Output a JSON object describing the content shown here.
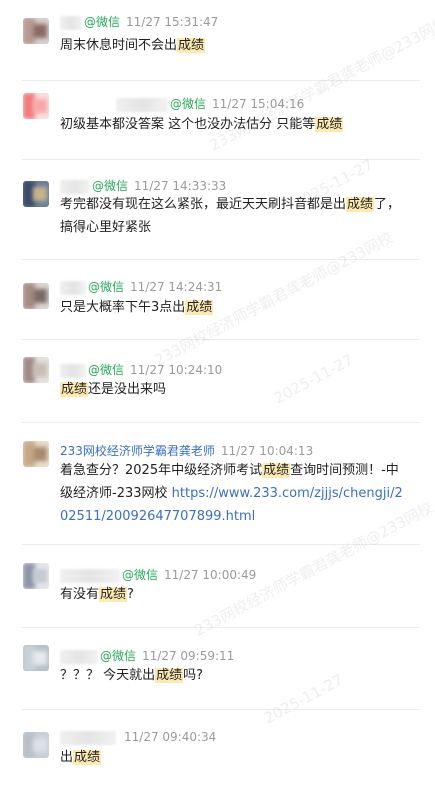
{
  "comments": [
    {
      "id": "c1",
      "nickname": "",
      "source": "@微信",
      "time": "11/27 15:31:47",
      "avatar_colors": [
        "#b89a93",
        "#8a6a66",
        "#d8cfcc"
      ],
      "segments": [
        {
          "text": "周末休息时间不会出",
          "hl": false
        },
        {
          "text": "成绩",
          "hl": true
        }
      ]
    },
    {
      "id": "c2",
      "nickname": "",
      "source": "@微信",
      "time": "11/27 15:04:16",
      "avatar_colors": [
        "#f27c7c",
        "#f6a7a7",
        "#fbdede"
      ],
      "segments": [
        {
          "text": "初级基本都没答案 这个也没办法估分 只能等",
          "hl": false
        },
        {
          "text": "成绩",
          "hl": true
        }
      ]
    },
    {
      "id": "c3",
      "nickname": "",
      "source": "@微信",
      "time": "11/27 14:33:33",
      "avatar_colors": [
        "#3b4a66",
        "#c7b38a",
        "#6d7f9a"
      ],
      "segments": [
        {
          "text": "考完都没有现在这么紧张，最近天天刷抖音都是出",
          "hl": false
        },
        {
          "text": "成绩",
          "hl": true
        },
        {
          "text": "了，搞得心里好紧张",
          "hl": false
        }
      ]
    },
    {
      "id": "c4",
      "nickname": "",
      "source": "@微信",
      "time": "11/27 14:24:31",
      "avatar_colors": [
        "#a88c85",
        "#7d6a66",
        "#ddd4d1"
      ],
      "segments": [
        {
          "text": "只是大概率下午3点出",
          "hl": false
        },
        {
          "text": "成绩",
          "hl": true
        }
      ]
    },
    {
      "id": "c5",
      "nickname": "",
      "source": "@微信",
      "time": "11/27 10:24:10",
      "avatar_colors": [
        "#9e8a86",
        "#c9bdb9",
        "#e6e0de"
      ],
      "segments": [
        {
          "text": "成绩",
          "hl": true
        },
        {
          "text": "还是没出来吗",
          "hl": false
        }
      ]
    },
    {
      "id": "c6",
      "nickname": "233网校经济师学霸君龚老师",
      "source": "",
      "time": "11/27 10:04:13",
      "avatar_colors": [
        "#c9a888",
        "#a98a6e",
        "#e9dccd"
      ],
      "segments": [
        {
          "text": "着急查分？2025年中级经济师考试",
          "hl": false
        },
        {
          "text": "成绩",
          "hl": true
        },
        {
          "text": "查询时间预测！-中级经济师-233网校 ",
          "hl": false
        },
        {
          "text": "https://www.233.com/zjjjs/chengji/202511/20092647707899.html",
          "hl": false,
          "link": true
        }
      ]
    },
    {
      "id": "c7",
      "nickname": "",
      "source": "@微信",
      "time": "11/27 10:00:49",
      "avatar_colors": [
        "#8d95a6",
        "#c4c8d1",
        "#e4e6eb"
      ],
      "segments": [
        {
          "text": "有没有",
          "hl": false
        },
        {
          "text": "成绩",
          "hl": true
        },
        {
          "text": "?",
          "hl": false
        }
      ]
    },
    {
      "id": "c8",
      "nickname": "",
      "source": "@微信",
      "time": "11/27 09:59:11",
      "avatar_colors": [
        "#c7d2d6",
        "#e4eaec",
        "#b6c3c8"
      ],
      "segments": [
        {
          "text": "？？？ 今天就出",
          "hl": false
        },
        {
          "text": "成绩",
          "hl": true
        },
        {
          "text": "吗?",
          "hl": false
        }
      ]
    },
    {
      "id": "c9",
      "nickname": "",
      "source": "",
      "time": "11/27 09:40:34",
      "avatar_colors": [
        "#b8c0c8",
        "#dde1e6",
        "#c9cfd6"
      ],
      "segments": [
        {
          "text": "出",
          "hl": false
        },
        {
          "text": "成绩",
          "hl": true
        }
      ]
    }
  ],
  "watermarks": [
    "233网校经济师学霸君龚老师@233网校",
    "2025-11-27",
    "233网校经济师学霸君龚老师@233网校",
    "2025-11-27",
    "233网校经济师学霸君龚老师@233网校",
    "2025-11-27"
  ]
}
